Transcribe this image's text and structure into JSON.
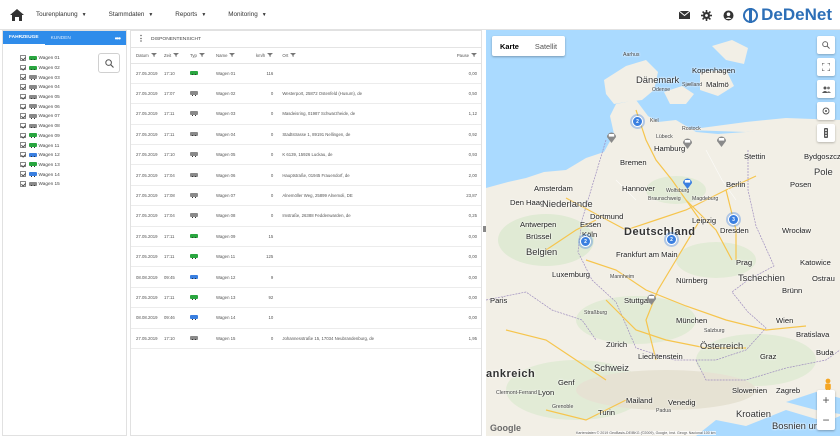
{
  "nav": {
    "items": [
      {
        "label": "Tourenplanung",
        "name": "nav-tourenplanung"
      },
      {
        "label": "Stammdaten",
        "name": "nav-stammdaten"
      },
      {
        "label": "Reports",
        "name": "nav-reports"
      },
      {
        "label": "Monitoring",
        "name": "nav-monitoring"
      }
    ],
    "brand": "DeDeNet"
  },
  "left_panel": {
    "tabs": [
      "FAHRZEUGE",
      "KUNDEN"
    ],
    "more": "•••",
    "vehicles": [
      {
        "label": "Wagen 01",
        "color": "#2aa640"
      },
      {
        "label": "Wagen 02",
        "color": "#2aa640"
      },
      {
        "label": "Wagen 03",
        "color": "#8a8a8a"
      },
      {
        "label": "Wagen 04",
        "color": "#8a8a8a"
      },
      {
        "label": "Wagen 05",
        "color": "#8a8a8a"
      },
      {
        "label": "Wagen 06",
        "color": "#8a8a8a"
      },
      {
        "label": "Wagen 07",
        "color": "#8a8a8a"
      },
      {
        "label": "Wagen 08",
        "color": "#8a8a8a"
      },
      {
        "label": "Wagen 09",
        "color": "#2aa640"
      },
      {
        "label": "Wagen 11",
        "color": "#2aa640"
      },
      {
        "label": "Wagen 12",
        "color": "#3a7fe0"
      },
      {
        "label": "Wagen 13",
        "color": "#2aa640"
      },
      {
        "label": "Wagen 14",
        "color": "#3a7fe0"
      },
      {
        "label": "Wagen 15",
        "color": "#8a8a8a"
      }
    ]
  },
  "dispo": {
    "title": "DISPONENTENSICHT",
    "columns": [
      "Datum",
      "Zeit",
      "Typ",
      "Name",
      "km/h",
      "Ort",
      "Pause"
    ],
    "rows": [
      {
        "date": "27.05.2019",
        "time": "17:10",
        "icon": "#2aa640",
        "name": "Wagen 01",
        "kmh": "116",
        "ort": "",
        "pause": "0,00"
      },
      {
        "date": "27.05.2019",
        "time": "17:07",
        "icon": "#8a8a8a",
        "name": "Wagen 02",
        "kmh": "0",
        "ort": "Westerport, 25872 Ostenfeld (Husum), de",
        "pause": "0,50"
      },
      {
        "date": "27.05.2019",
        "time": "17:11",
        "icon": "#8a8a8a",
        "name": "Wagen 03",
        "kmh": "0",
        "ort": "Masdeisring, 01987 Schwarzheide, de",
        "pause": "1,12"
      },
      {
        "date": "27.05.2019",
        "time": "17:11",
        "icon": "#8a8a8a",
        "name": "Wagen 04",
        "kmh": "0",
        "ort": "Stadtstrasse 1, 89191 Nellingen, de",
        "pause": "0,92"
      },
      {
        "date": "27.05.2019",
        "time": "17:10",
        "icon": "#8a8a8a",
        "name": "Wagen 05",
        "kmh": "0",
        "ort": "K 6139, 15926 Luckau, de",
        "pause": "0,93"
      },
      {
        "date": "27.05.2019",
        "time": "17:04",
        "icon": "#8a8a8a",
        "name": "Wagen 06",
        "kmh": "0",
        "ort": "Hauptstraße, 01945 Frauendorf, de",
        "pause": "2,00"
      },
      {
        "date": "27.05.2019",
        "time": "17:08",
        "icon": "#8a8a8a",
        "name": "Wagen 07",
        "kmh": "0",
        "ort": "Alnemöller Weg, 25899 Alnemoli, DE",
        "pause": "23,87"
      },
      {
        "date": "27.05.2019",
        "time": "17:04",
        "icon": "#8a8a8a",
        "name": "Wagen 08",
        "kmh": "0",
        "ort": "Imstraße, 26388 Feddenwarden, de",
        "pause": "0,25"
      },
      {
        "date": "27.05.2019",
        "time": "17:11",
        "icon": "#2aa640",
        "name": "Wagen 09",
        "kmh": "15",
        "ort": "",
        "pause": "0,00"
      },
      {
        "date": "27.05.2019",
        "time": "17:11",
        "icon": "#2aa640",
        "name": "Wagen 11",
        "kmh": "125",
        "ort": "",
        "pause": "0,00"
      },
      {
        "date": "08.08.2019",
        "time": "09:45",
        "icon": "#3a7fe0",
        "name": "Wagen 12",
        "kmh": "9",
        "ort": "",
        "pause": "0,00"
      },
      {
        "date": "27.05.2019",
        "time": "17:11",
        "icon": "#2aa640",
        "name": "Wagen 13",
        "kmh": "92",
        "ort": "",
        "pause": "0,00"
      },
      {
        "date": "08.08.2019",
        "time": "09:46",
        "icon": "#3a7fe0",
        "name": "Wagen 14",
        "kmh": "10",
        "ort": "",
        "pause": "0,00"
      },
      {
        "date": "27.05.2019",
        "time": "17:10",
        "icon": "#8a8a8a",
        "name": "Wagen 15",
        "kmh": "0",
        "ort": "Johannesstraße 15, 17034 Neubrandenburg, de",
        "pause": "1,95"
      }
    ]
  },
  "map": {
    "type_on": "Karte",
    "type_off": "Satellit",
    "google": "Google",
    "attribution": "Kartendaten © 2019 GeoBasis-DE/BKG (©2009), Google, Inst. Geogr. Nacional   100 km",
    "cities": {
      "aarhus": "Aarhus",
      "kopenhagen": "Kopenhagen",
      "daenemark": "Dänemark",
      "odense": "Odense",
      "malmo": "Malmö",
      "sjaelland": "Sjælland",
      "kiel": "Kiel",
      "rostock": "Rostock",
      "lubeck": "Lübeck",
      "hamburg": "Hamburg",
      "stettin": "Stettin",
      "bydgoszcz": "Bydgoszcz",
      "bremen": "Bremen",
      "pole": "Pole",
      "amsterdam": "Amsterdam",
      "hannover": "Hannover",
      "berlin": "Berlin",
      "posen": "Posen",
      "denhaag": "Den Haag",
      "niederlande": "Niederlande",
      "wolfsburg": "Wolfsburg",
      "braunschweig": "Braunschweig",
      "magdeburg": "Magdeburg",
      "dortmund": "Dortmund",
      "essen": "Essen",
      "antwerpen": "Antwerpen",
      "leipzig": "Leipzig",
      "dresden": "Dresden",
      "wroclaw": "Wrocław",
      "brussel": "Brüssel",
      "koln": "Köln",
      "deutschland": "Deutschland",
      "belgien": "Belgien",
      "frankfurt": "Frankfurt am Main",
      "prag": "Prag",
      "katowice": "Katowice",
      "luxemburg": "Luxemburg",
      "tschechien": "Tschechien",
      "ostrau": "Ostrau",
      "mannheim": "Mannheim",
      "nurnberg": "Nürnberg",
      "brunn": "Brünn",
      "paris": "Paris",
      "stuttgart": "Stuttgart",
      "strassburg": "Straßburg",
      "munchen": "München",
      "wien": "Wien",
      "bratislava": "Bratislava",
      "salzburg": "Salzburg",
      "zurich": "Zürich",
      "osterreich": "Österreich",
      "liechtenstein": "Liechtenstein",
      "graz": "Graz",
      "schweiz": "Schweiz",
      "budapest": "Buda",
      "frankreich": "ankreich",
      "lyon": "Lyon",
      "genf": "Genf",
      "slowenien": "Slowenien",
      "zagreb": "Zagreb",
      "clermont": "Clermont-Ferrand",
      "mailand": "Mailand",
      "venedig": "Venedig",
      "grenoble": "Grenoble",
      "turin": "Turin",
      "kroatien": "Kroatien",
      "padua": "Padua",
      "bosnien": "Bosnien und"
    },
    "clusters": [
      "2",
      "2",
      "3",
      "2"
    ]
  },
  "colors": {
    "accent": "#2f8cea",
    "brand": "#2d6fb7",
    "green": "#2aa640",
    "grey": "#8a8a8a",
    "blue": "#3a7fe0"
  }
}
